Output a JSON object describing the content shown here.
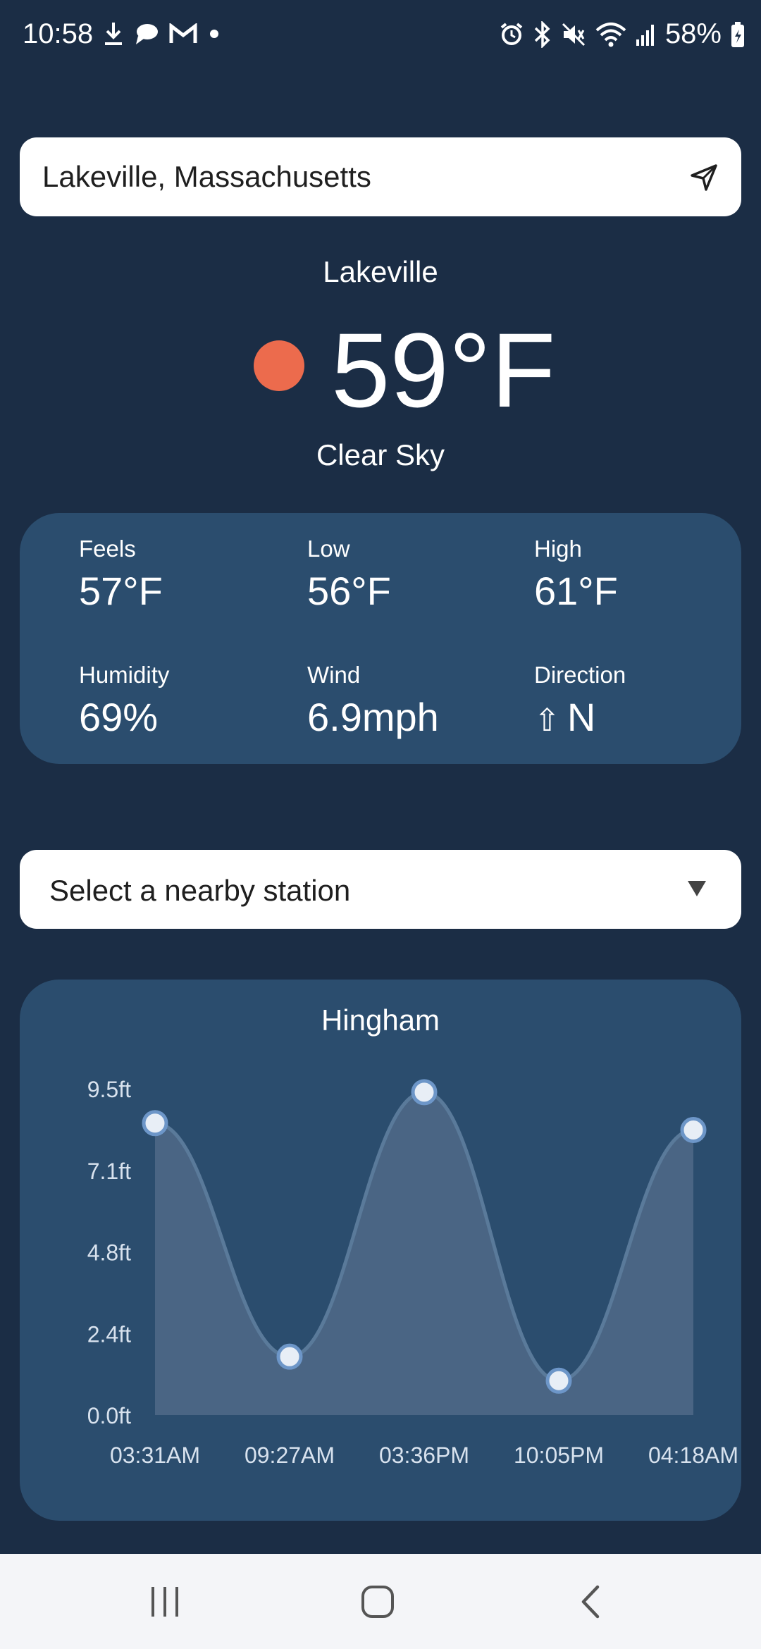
{
  "status_bar": {
    "time": "10:58",
    "battery": "58%",
    "left_icons": [
      "download-icon",
      "chat-icon",
      "gmail-icon",
      "dot-icon"
    ],
    "right_icons": [
      "alarm-icon",
      "bluetooth-icon",
      "mute-icon",
      "wifi-icon",
      "signal-icon",
      "battery-icon"
    ]
  },
  "search": {
    "value": "Lakeville, Massachusetts",
    "locate_icon": "location-arrow-icon"
  },
  "current": {
    "city": "Lakeville",
    "temperature": "59°F",
    "condition": "Clear Sky",
    "icon": "sun-icon",
    "icon_color": "#ec6b4d"
  },
  "details": {
    "feels": {
      "label": "Feels",
      "value": "57°F"
    },
    "low": {
      "label": "Low",
      "value": "56°F"
    },
    "high": {
      "label": "High",
      "value": "61°F"
    },
    "humidity": {
      "label": "Humidity",
      "value": "69%"
    },
    "wind": {
      "label": "Wind",
      "value": "6.9mph"
    },
    "direction": {
      "label": "Direction",
      "arrow": "⇧",
      "value": "N"
    }
  },
  "station": {
    "placeholder": "Select a nearby station",
    "icon": "dropdown-arrow-icon"
  },
  "chart_data": {
    "type": "line",
    "title": "Hingham",
    "categories": [
      "03:31AM",
      "09:27AM",
      "03:36PM",
      "10:05PM",
      "04:18AM"
    ],
    "values": [
      8.5,
      1.7,
      9.4,
      1.0,
      8.3
    ],
    "y_ticks": [
      "9.5ft",
      "7.1ft",
      "4.8ft",
      "2.4ft",
      "0.0ft"
    ],
    "ylim": [
      0,
      9.5
    ],
    "xlabel": "",
    "ylabel": "",
    "grid": false,
    "smooth": true,
    "line_color": "#5a7a9a",
    "fill_color": "#4a6584",
    "marker_color": "#e8eef6"
  },
  "nav": {
    "recents_icon": "recents-icon",
    "home_icon": "home-icon",
    "back_icon": "back-icon"
  },
  "colors": {
    "background": "#1b2d45",
    "card": "#2b4d6e",
    "accent_sun": "#ec6b4d"
  }
}
